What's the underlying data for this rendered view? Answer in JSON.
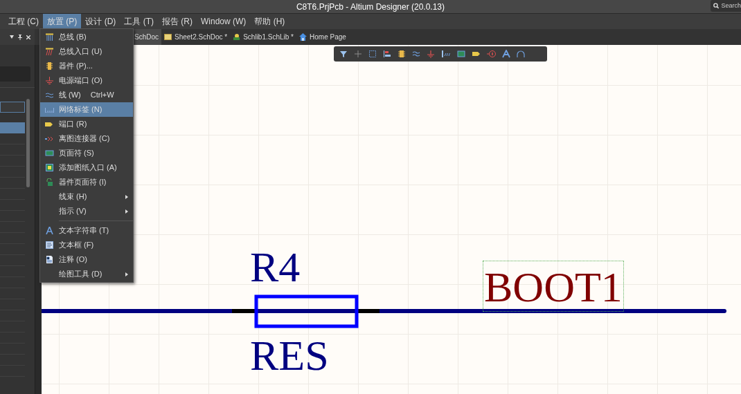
{
  "window": {
    "title": "C8T6.PrjPcb - Altium Designer (20.0.13)"
  },
  "search": {
    "placeholder": "Search"
  },
  "menubar": [
    {
      "label": "工程 (C)",
      "selected": false
    },
    {
      "label": "放置 (P)",
      "selected": true
    },
    {
      "label": "设计 (D)",
      "selected": false
    },
    {
      "label": "工具 (T)",
      "selected": false
    },
    {
      "label": "报告 (R)",
      "selected": false
    },
    {
      "label": "Window (W)",
      "selected": false
    },
    {
      "label": "帮助 (H)",
      "selected": false
    }
  ],
  "tabs": [
    {
      "label": "SchDoc",
      "selected": true
    },
    {
      "label": "Sheet2.SchDoc *",
      "selected": false
    },
    {
      "label": "Schlib1.SchLib *",
      "selected": false
    },
    {
      "label": "Home Page",
      "selected": false
    }
  ],
  "menu": {
    "groups": [
      [
        {
          "label": "总线 (B)",
          "selected": false
        },
        {
          "label": "总线入口 (U)",
          "selected": false
        },
        {
          "label": "器件 (P)...",
          "selected": false
        },
        {
          "label": "电源端口 (O)",
          "selected": false
        },
        {
          "label": "线 (W)",
          "shortcut": "Ctrl+W",
          "selected": false
        },
        {
          "label": "网络标签 (N)",
          "selected": true
        },
        {
          "label": "端口 (R)",
          "selected": false
        },
        {
          "label": "离图连接器 (C)",
          "selected": false
        },
        {
          "label": "页面符 (S)",
          "selected": false
        },
        {
          "label": "添加图纸入口 (A)",
          "selected": false
        },
        {
          "label": "器件页面符 (I)",
          "selected": false
        },
        {
          "label": "线束 (H)",
          "submenu": true,
          "selected": false
        },
        {
          "label": "指示 (V)",
          "submenu": true,
          "selected": false
        }
      ],
      [
        {
          "label": "文本字符串 (T)",
          "selected": false
        },
        {
          "label": "文本框 (F)",
          "selected": false
        },
        {
          "label": "注释 (O)",
          "selected": false
        },
        {
          "label": "绘图工具 (D)",
          "submenu": true,
          "selected": false
        }
      ]
    ]
  },
  "schematic": {
    "designator": "R4",
    "comment": "RES",
    "net_label": {
      "text": "BOOT1",
      "selected": true
    }
  }
}
